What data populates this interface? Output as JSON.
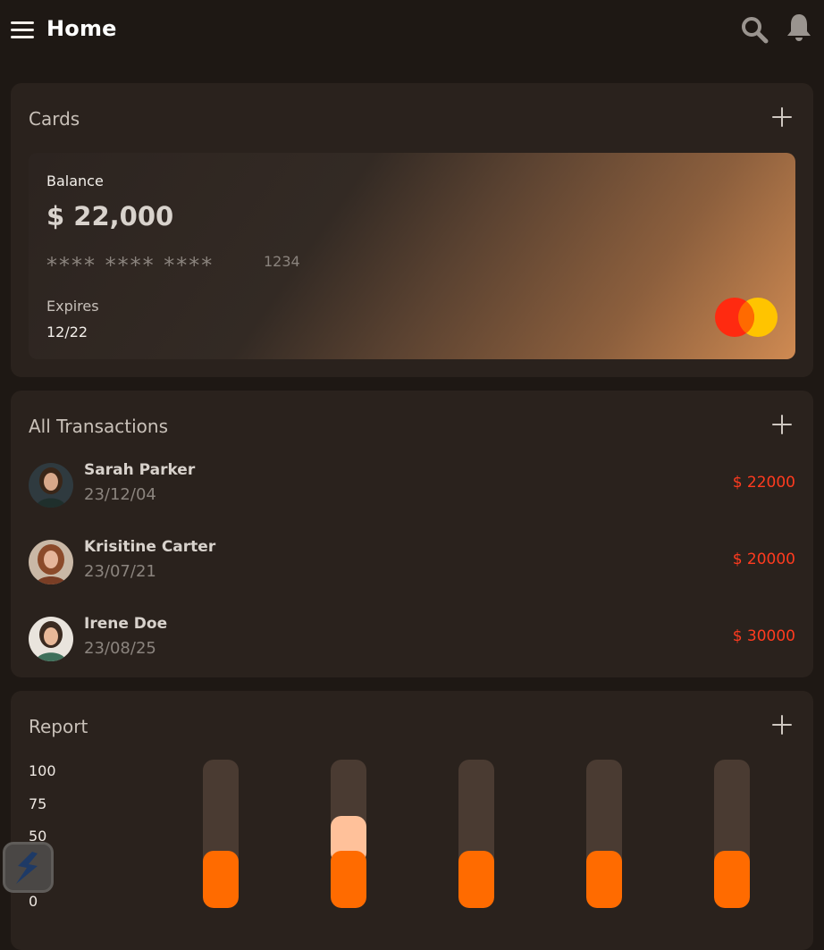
{
  "header": {
    "title": "Home",
    "menu_icon": "hamburger-menu-icon",
    "search_icon": "search-icon",
    "bell_icon": "bell-icon"
  },
  "cards": {
    "title": "Cards",
    "card": {
      "balance_label": "Balance",
      "balance": "$ 22,000",
      "masked_number": "**** **** ****",
      "last4": "1234",
      "expires_label": "Expires",
      "expiry": "12/22",
      "brand_icon": "mastercard-logo-icon"
    }
  },
  "transactions": {
    "title": "All Transactions",
    "items": [
      {
        "name": "Sarah Parker",
        "date": "23/12/04",
        "amount": "$ 22000"
      },
      {
        "name": "Krisitine Carter",
        "date": "23/07/21",
        "amount": "$ 20000"
      },
      {
        "name": "Irene Doe",
        "date": "23/08/25",
        "amount": "$ 30000"
      }
    ]
  },
  "report": {
    "title": "Report"
  },
  "chart_data": {
    "type": "bar",
    "y_ticks": [
      "100",
      "75",
      "50",
      "25",
      "0"
    ],
    "ylim": [
      0,
      100
    ],
    "categories": [
      "",
      "",
      "",
      "",
      ""
    ],
    "series": [
      {
        "values": [
          25,
          25,
          25,
          25,
          25
        ],
        "color": "#ff6b00"
      },
      {
        "values": [
          0,
          20,
          0,
          0,
          0
        ],
        "color": "#ffc19a"
      }
    ],
    "track_color": "#4a3b32"
  },
  "colors": {
    "background": "#1e1814",
    "panel": "#2a221d",
    "accent_orange": "#ff6b00",
    "amount_red": "#ff3b1f"
  }
}
